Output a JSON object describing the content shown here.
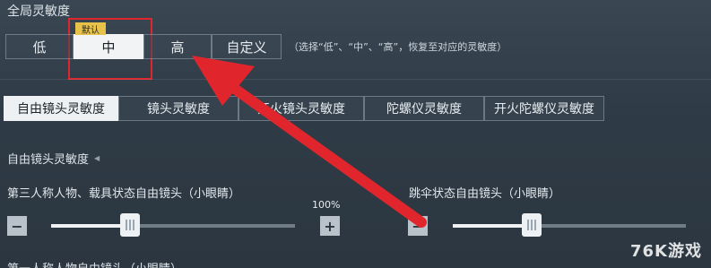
{
  "global": {
    "title": "全局灵敏度",
    "presets": [
      "低",
      "中",
      "高",
      "自定义"
    ],
    "selected_preset": "中",
    "default_badge": "默认",
    "hint": "（选择“低”、“中”、“高”，恢复至对应的灵敏度）"
  },
  "tabs": [
    "自由镜头灵敏度",
    "镜头灵敏度",
    "开火镜头灵敏度",
    "陀螺仪灵敏度",
    "开火陀螺仪灵敏度"
  ],
  "active_tab": "自由镜头灵敏度",
  "section": {
    "title": "自由镜头灵敏度",
    "slider1": {
      "label": "第三人称人物、载具状态自由镜头（小眼睛）",
      "value_text": "100%",
      "value": 0.3
    },
    "slider2": {
      "label": "跳伞状态自由镜头（小眼睛）",
      "value": 0.36
    },
    "next_label": "第一人称人物自由镜头（小眼睛）"
  },
  "icons": {
    "minus": "−",
    "plus": "+"
  },
  "annotation_color": "#e0262c",
  "watermark": "76K游戏"
}
